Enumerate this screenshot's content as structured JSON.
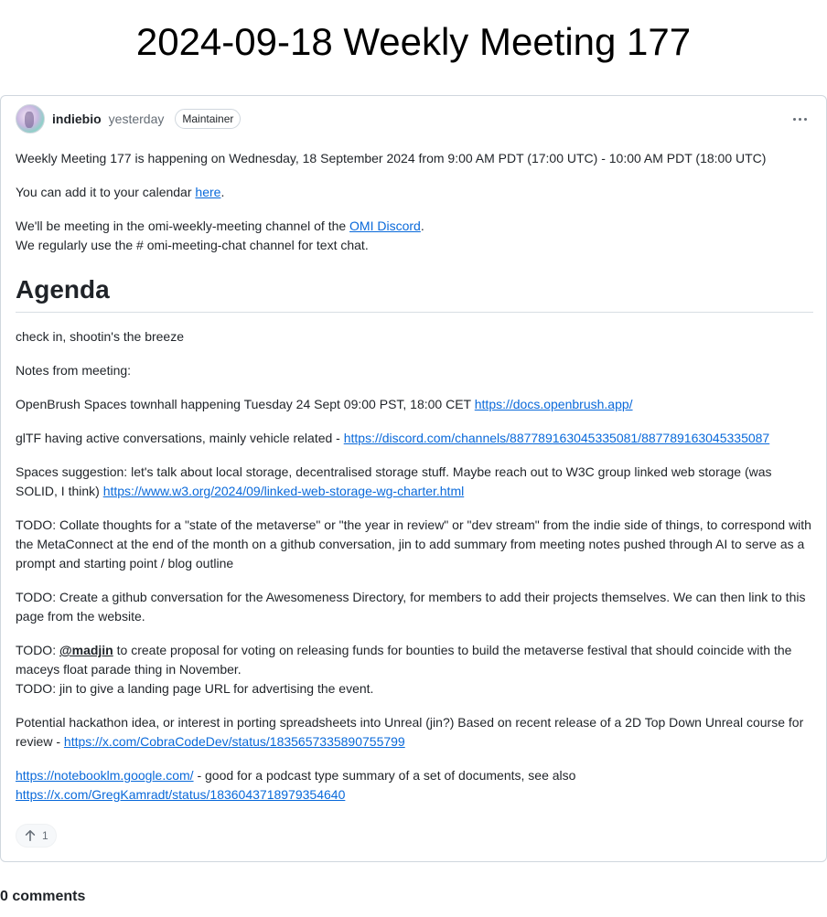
{
  "page": {
    "title": "2024-09-18 Weekly Meeting 177"
  },
  "post": {
    "author": "indiebio",
    "time": "yesterday",
    "role": "Maintainer",
    "avatar_icon": "avatar-icon",
    "menu_icon": "kebab-menu-icon",
    "intro": "Weekly Meeting 177 is happening on Wednesday, 18 September 2024 from 9:00 AM PDT (17:00 UTC) - 10:00 AM PDT (18:00 UTC)",
    "calendar_text": "You can add it to your calendar ",
    "calendar_link": "here",
    "calendar_suffix": ".",
    "discord_text": "We'll be meeting in the omi-weekly-meeting channel of the ",
    "discord_link": "OMI Discord",
    "discord_suffix": ".",
    "chat_text": "We regularly use the # omi-meeting-chat channel for text chat.",
    "agenda_heading": "Agenda",
    "checkin": "check in, shootin's the breeze",
    "notes_label": "Notes from meeting:",
    "openbrush_text": "OpenBrush Spaces townhall happening Tuesday 24 Sept 09:00 PST, 18:00 CET ",
    "openbrush_link": "https://docs.openbrush.app/",
    "gltf_text": "glTF having active conversations, mainly vehicle related - ",
    "gltf_link": "https://discord.com/channels/887789163045335081/887789163045335087",
    "spaces_text": "Spaces suggestion: let's talk about local storage, decentralised storage stuff. Maybe reach out to W3C group linked web storage (was SOLID, I think) ",
    "spaces_link": "https://www.w3.org/2024/09/linked-web-storage-wg-charter.html",
    "todo1": "TODO: Collate thoughts for a \"state of the metaverse\" or \"the year in review\" or \"dev stream\" from the indie side of things, to correspond with the MetaConnect at the end of the month on a github conversation, jin to add summary from meeting notes pushed through AI to serve as a prompt and starting point / blog outline",
    "todo2": "TODO: Create a github conversation for the Awesomeness Directory, for members to add their projects themselves. We can then link to this page from the website.",
    "todo3_prefix": "TODO: ",
    "todo3_mention": "@madjin",
    "todo3_text": " to create proposal for voting on releasing funds for bounties to build the metaverse festival that should coincide with the maceys float parade thing in November.",
    "todo4": "TODO: jin to give a landing page URL for advertising the event.",
    "hackathon_text": "Potential hackathon idea, or interest in porting spreadsheets into Unreal (jin?) Based on recent release of a 2D Top Down Unreal course for review - ",
    "hackathon_link": "https://x.com/CobraCodeDev/status/1835657335890755799",
    "notebook_link": "https://notebooklm.google.com/",
    "notebook_text": " - good for a podcast type summary of a set of documents, see also",
    "greg_link": "https://x.com/GregKamradt/status/1836043718979354640",
    "upvote_icon": "arrow-up-icon",
    "upvotes": "1"
  },
  "comments": {
    "count_label": "0 comments"
  }
}
